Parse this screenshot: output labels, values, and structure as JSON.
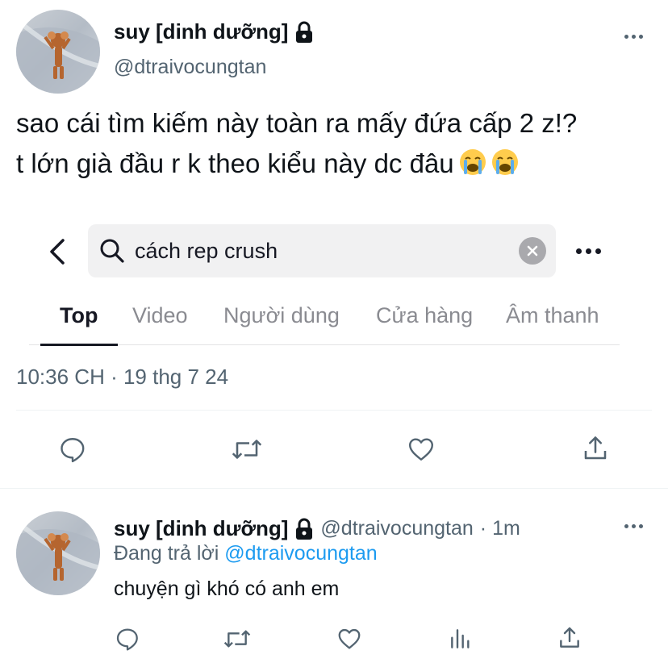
{
  "tweet": {
    "author": {
      "display_name": "suy [dinh dưỡng]",
      "handle": "@dtraivocungtan",
      "avatar_icon": "mouse-cartoon-avatar",
      "lock_icon": "lock-icon"
    },
    "text_lines": [
      "sao cái tìm kiếm này toàn ra mấy đứa cấp 2 z!?",
      "t lớn già đầu r k theo kiểu này dc đâu"
    ],
    "emojis": [
      "loudly-crying-face",
      "loudly-crying-face"
    ],
    "embedded_screenshot": {
      "search_query": "cách rep crush",
      "tabs": [
        "Top",
        "Video",
        "Người dùng",
        "Cửa hàng",
        "Âm thanh"
      ],
      "active_tab": "Top"
    },
    "timestamp": "10:36 CH · 19 thg 7 24",
    "actions": [
      "reply-icon",
      "retweet-icon",
      "like-icon",
      "share-icon"
    ]
  },
  "reply": {
    "author": {
      "display_name": "suy [dinh dưỡng]",
      "handle": "@dtraivocungtan",
      "time": "· 1m"
    },
    "replying_to_label": "Đang trả lời",
    "replying_to_handle": "@dtraivocungtan",
    "text": "chuyện gì khó có anh em",
    "actions": [
      "reply-icon",
      "retweet-icon",
      "like-icon",
      "views-icon",
      "share-icon"
    ]
  },
  "colors": {
    "text": "#0f1419",
    "secondary": "#536471",
    "link": "#1d9bf0",
    "divider": "#eff3f4"
  }
}
